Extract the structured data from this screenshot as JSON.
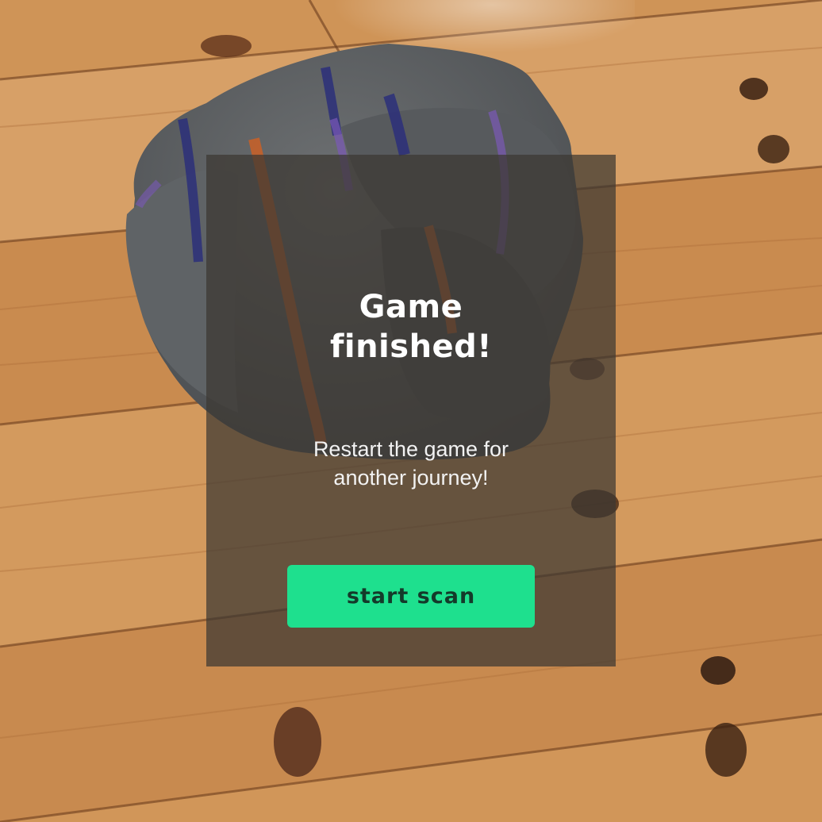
{
  "game_over_panel": {
    "title_line1": "Game",
    "title_line2": "finished!",
    "message_line1": "Restart the game for",
    "message_line2": "another journey!",
    "button_label": "start scan",
    "button_color": "#1ee08e"
  }
}
